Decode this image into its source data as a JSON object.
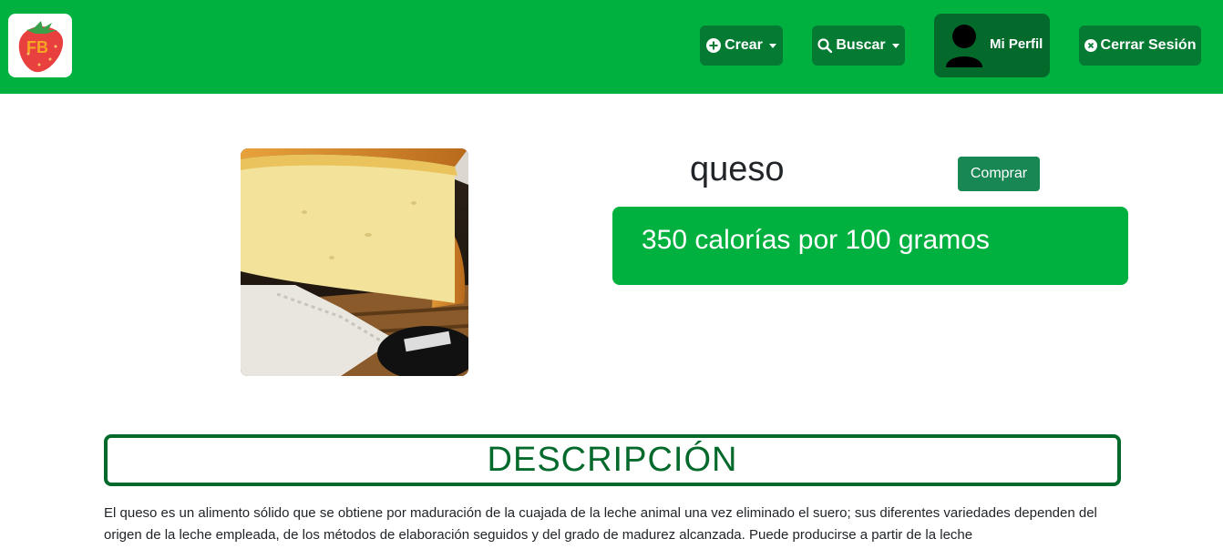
{
  "navbar": {
    "logo_text": "FB",
    "crear_label": "Crear",
    "buscar_label": "Buscar",
    "perfil_label": "Mi Perfil",
    "cerrar_label": "Cerrar Sesión",
    "colors": {
      "bar": "#00b140",
      "button": "#057a33"
    }
  },
  "product": {
    "name": "queso",
    "buy_label": "Comprar",
    "calories": "350 calorías por 100 gramos"
  },
  "description": {
    "title": "DESCRIPCIÓN",
    "text": "El queso es un alimento sólido que se obtiene por maduración de la cuajada de la leche animal una vez eliminado el suero; sus diferentes variedades dependen del origen de la leche empleada, de los métodos de elaboración seguidos y del grado de madurez alcanzada. Puede producirse a partir de la leche"
  },
  "icons": {
    "crear": "plus-circle-icon",
    "buscar": "search-icon",
    "perfil": "user-avatar-icon",
    "cerrar": "x-circle-icon",
    "logo": "strawberry-logo-icon"
  }
}
